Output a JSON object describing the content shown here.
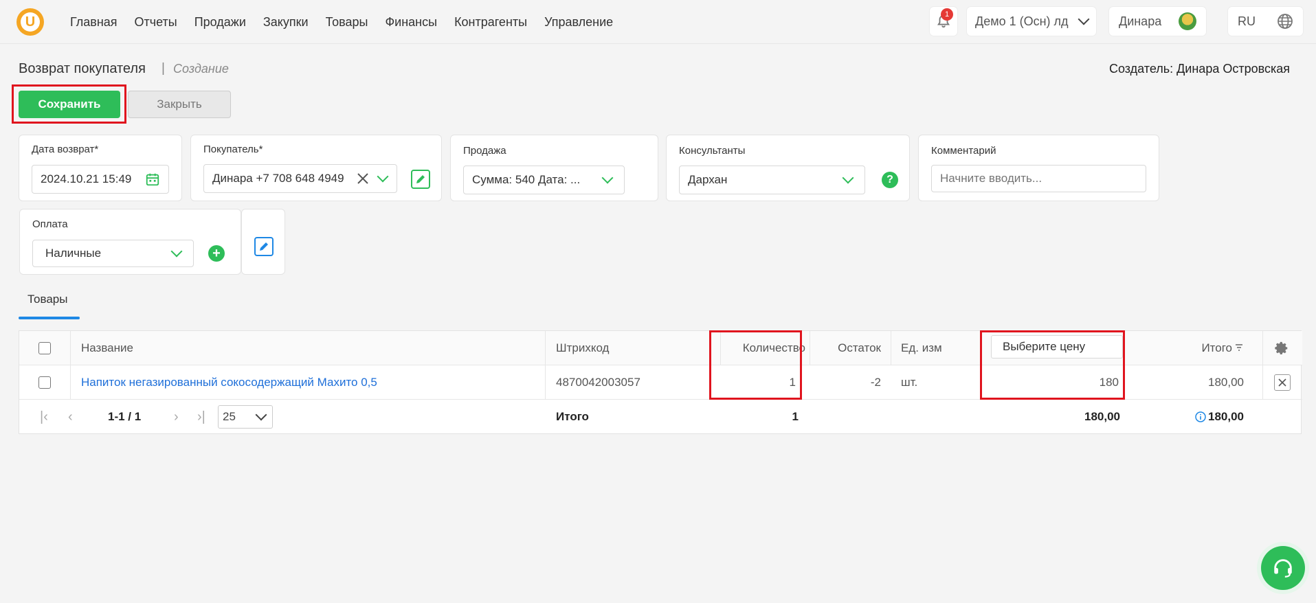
{
  "nav": {
    "items": [
      "Главная",
      "Отчеты",
      "Продажи",
      "Закупки",
      "Товары",
      "Финансы",
      "Контрагенты",
      "Управление"
    ],
    "notifications_count": "1",
    "company": "Демо 1 (Осн) лд",
    "user": "Динара",
    "lang": "RU"
  },
  "page": {
    "title": "Возврат покупателя",
    "separator": "|",
    "subtitle": "Создание",
    "creator": "Создатель: Динара Островская",
    "save_label": "Сохранить",
    "close_label": "Закрыть"
  },
  "form": {
    "date_label": "Дата возврат*",
    "date_value": "2024.10.21 15:49",
    "buyer_label": "Покупатель*",
    "buyer_value": "Динара +7 708 648 4949",
    "sale_label": "Продажа",
    "sale_value": "Сумма: 540 Дата: ...",
    "consultants_label": "Консультанты",
    "consultants_value": "Дархан",
    "comment_label": "Комментарий",
    "comment_placeholder": "Начните вводить...",
    "payment_label": "Оплата",
    "payment_value": "Наличные"
  },
  "tabs": {
    "goods": "Товары"
  },
  "table": {
    "headers": {
      "name": "Название",
      "barcode": "Штрихкод",
      "quantity": "Количество",
      "stock": "Остаток",
      "unit": "Ед. изм",
      "price_select": "Выберите цену",
      "total": "Итого"
    },
    "rows": [
      {
        "name": "Напиток негазированный сокосодержащий Махито 0,5",
        "barcode": "4870042003057",
        "quantity": "1",
        "stock": "-2",
        "unit": "шт.",
        "price": "180",
        "total": "180,00"
      }
    ],
    "footer": {
      "range": "1-1 / 1",
      "page_size": "25",
      "total_label": "Итого",
      "total_quantity": "1",
      "total_price": "180,00",
      "grand_total": "180,00"
    }
  },
  "colors": {
    "accent_green": "#2ebd59",
    "link_blue": "#1e6fd9",
    "highlight_red": "#e0141e"
  }
}
